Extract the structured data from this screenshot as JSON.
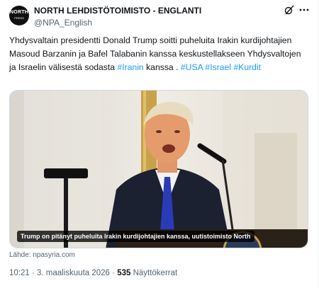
{
  "header": {
    "display_name": "NORTH LEHDISTÖTOIMISTO - ENGLANTI",
    "handle": "@NPA_English",
    "avatar_text": "NORTH",
    "avatar_subtext": "PRESS"
  },
  "tweet": {
    "text_parts": [
      "Yhdysvaltain presidentti Donald Trump soitti puheluita Irakin kurdijohtajien Masoud Barzanin ja Bafel Talabanin kanssa keskustellakseen Yhdysvaltojen ja Israelin välisestä sodasta ",
      "#Iranin",
      " kanssa . ",
      "#USA",
      " ",
      "#Israel",
      " ",
      "#Kurdit"
    ]
  },
  "media": {
    "caption": "Trump on pitänyt puheluita Irakin kurdijohtajien kanssa, uutistoimisto North",
    "source_prefix": "Lähde: ",
    "source": "npasyria.com"
  },
  "meta": {
    "time": "10:21",
    "separator": " · ",
    "date": "3. maaliskuuta 2026",
    "views_count": "535",
    "views_label": " Näyttökerrat"
  },
  "icons": {
    "grok": "grok-icon",
    "more": "more-icon"
  },
  "colors": {
    "link": "#1d9bf0",
    "text": "#0f1419",
    "secondary": "#536471"
  }
}
